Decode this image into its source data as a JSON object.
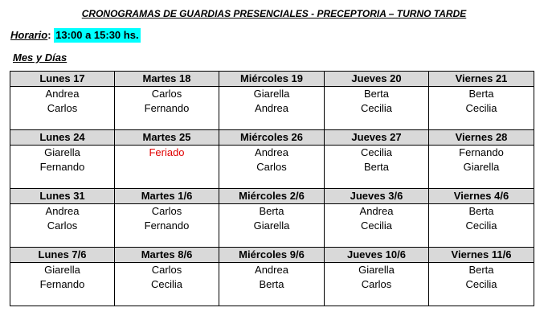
{
  "title": "CRONOGRAMAS DE GUARDIAS PRESENCIALES - PRECEPTORIA – TURNO TARDE",
  "horario": {
    "label": "Horario",
    "separator": ":",
    "value": "13:00 a 15:30 hs."
  },
  "mes_label": "Mes y Días",
  "colors": {
    "header_bg": "#d9d9d9",
    "highlight": "#00ffff",
    "holiday": "#e00000"
  },
  "weeks": [
    {
      "days": [
        {
          "day": "Lunes 17",
          "names": [
            "Andrea",
            "Carlos"
          ]
        },
        {
          "day": "Martes 18",
          "names": [
            "Carlos",
            "Fernando"
          ]
        },
        {
          "day": "Miércoles 19",
          "names": [
            "Giarella",
            "Andrea"
          ]
        },
        {
          "day": "Jueves 20",
          "names": [
            "Berta",
            "Cecilia"
          ]
        },
        {
          "day": "Viernes 21",
          "names": [
            "Berta",
            "Cecilia"
          ]
        }
      ]
    },
    {
      "days": [
        {
          "day": "Lunes 24",
          "names": [
            "Giarella",
            "Fernando"
          ]
        },
        {
          "day": "Martes 25",
          "names": [
            "",
            "Feriado"
          ]
        },
        {
          "day": "Miércoles 26",
          "names": [
            "Andrea",
            "Carlos"
          ]
        },
        {
          "day": "Jueves 27",
          "names": [
            "Cecilia",
            "Berta"
          ]
        },
        {
          "day": "Viernes 28",
          "names": [
            "Fernando",
            "Giarella"
          ]
        }
      ]
    },
    {
      "days": [
        {
          "day": "Lunes 31",
          "names": [
            "Andrea",
            "Carlos"
          ]
        },
        {
          "day": "Martes 1/6",
          "names": [
            "Carlos",
            "Fernando"
          ]
        },
        {
          "day": "Miércoles 2/6",
          "names": [
            "Berta",
            "Giarella"
          ]
        },
        {
          "day": "Jueves 3/6",
          "names": [
            "Andrea",
            "Cecilia"
          ]
        },
        {
          "day": "Viernes 4/6",
          "names": [
            "Berta",
            "Cecilia"
          ]
        }
      ]
    },
    {
      "days": [
        {
          "day": "Lunes 7/6",
          "names": [
            "Giarella",
            "Fernando"
          ]
        },
        {
          "day": "Martes 8/6",
          "names": [
            "Carlos",
            "Cecilia"
          ]
        },
        {
          "day": "Miércoles 9/6",
          "names": [
            "Andrea",
            "Berta"
          ]
        },
        {
          "day": "Jueves 10/6",
          "names": [
            "Giarella",
            "Carlos"
          ]
        },
        {
          "day": "Viernes 11/6",
          "names": [
            "Berta",
            "Cecilia"
          ]
        }
      ]
    }
  ]
}
